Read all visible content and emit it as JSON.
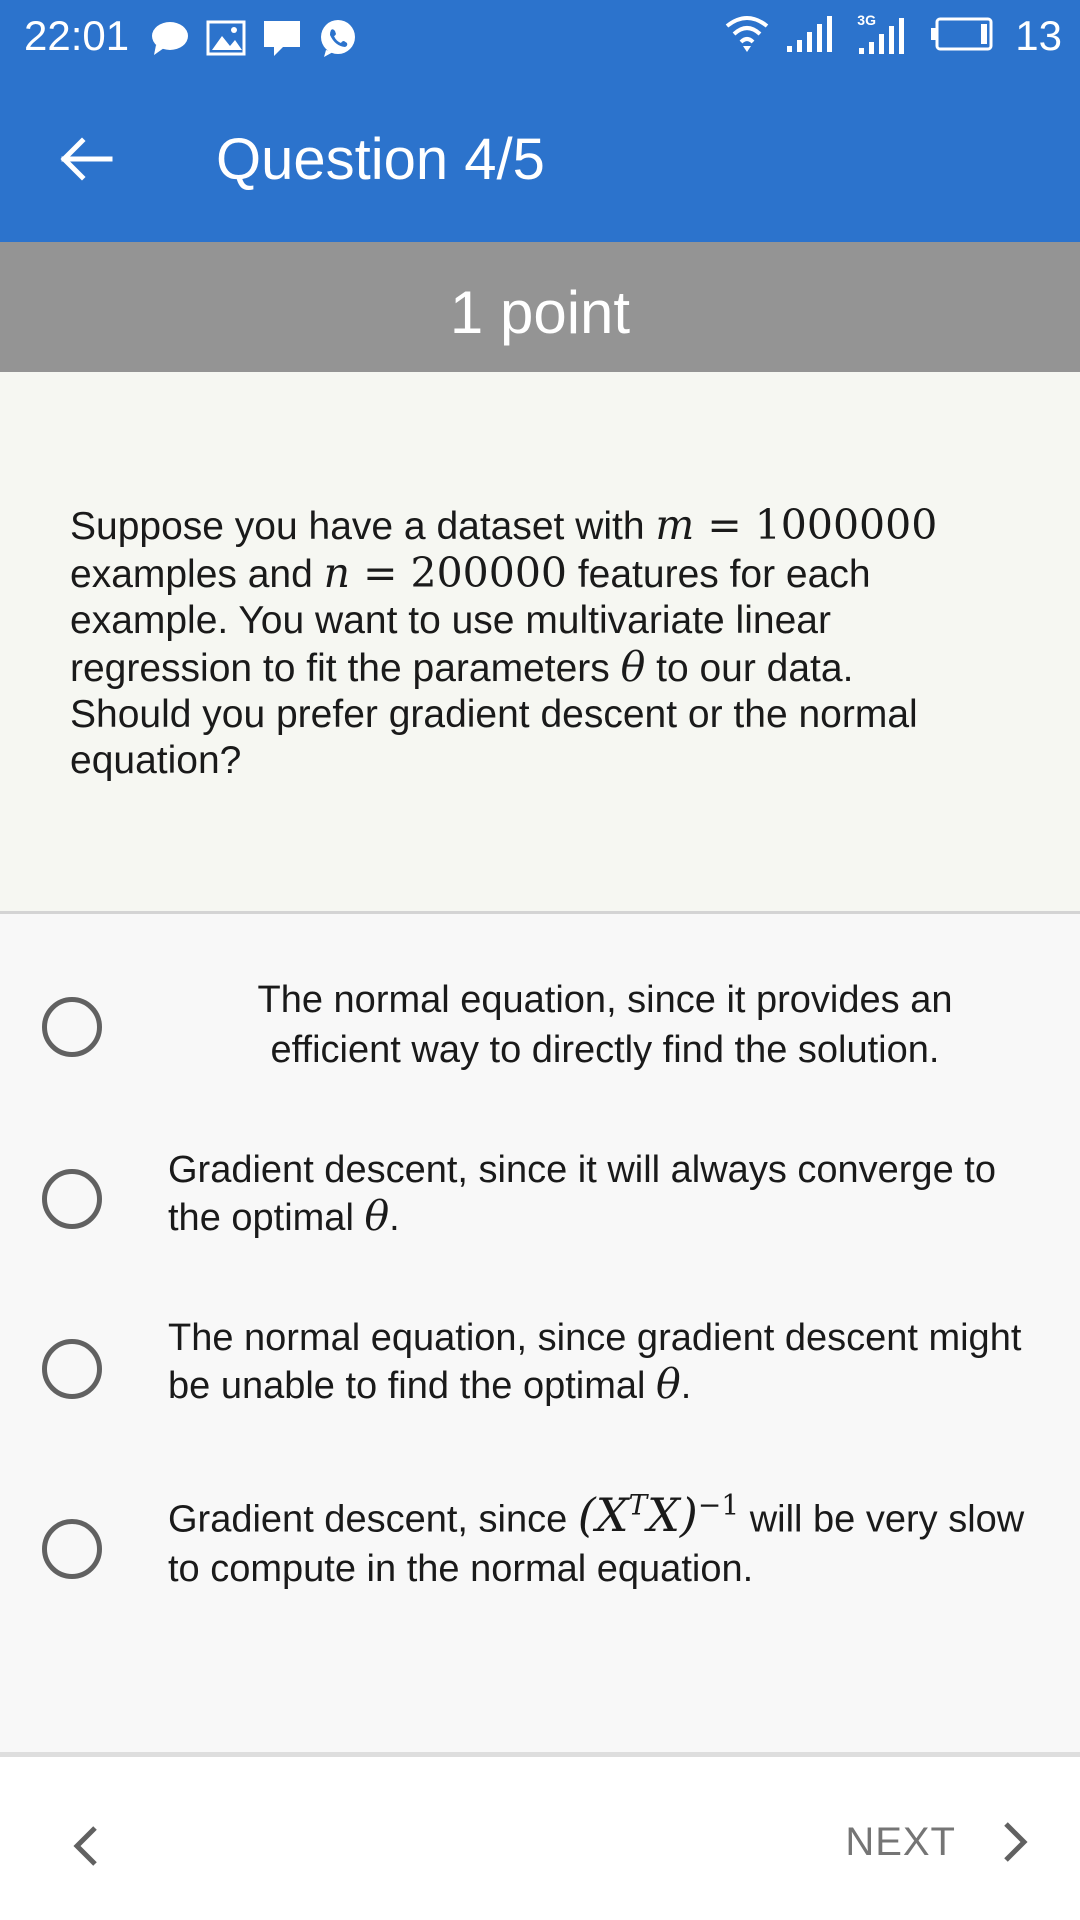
{
  "status_bar": {
    "time": "22:01",
    "battery_level": "13",
    "network_label": "3G",
    "icons_left": [
      "chat-bubble-icon",
      "image-icon",
      "message-icon",
      "viber-icon"
    ],
    "icons_right": [
      "wifi-icon",
      "signal-icon",
      "signal-3g-icon",
      "battery-icon"
    ]
  },
  "app_bar": {
    "title": "Question 4/5",
    "back_icon": "arrow-left-icon",
    "color": "#2c73cc"
  },
  "points": {
    "label": "1 point",
    "color": "#949494"
  },
  "question": {
    "t1": "Suppose you have a dataset with ",
    "m_var": "m",
    "eq1": " = ",
    "m_val": "1000000",
    "t2": " examples and ",
    "n_var": "n",
    "eq2": " = ",
    "n_val": "200000",
    "t3": " features for each example. You want to use multivariate linear regression to fit the parameters ",
    "theta": "θ",
    "t4": " to our data. Should you prefer gradient descent or the normal equation?"
  },
  "options": [
    {
      "text": "The normal equation, since it provides an efficient way to directly find the solution."
    },
    {
      "text": "Gradient descent, since it will always converge to the optimal ",
      "theta": "θ",
      "end": "."
    },
    {
      "text": "The normal equation, since gradient descent might be unable to find the optimal ",
      "theta": "θ",
      "end": "."
    },
    {
      "pre": "Gradient descent, since ",
      "formula_base": "(X",
      "formula_sup_T": "T",
      "formula_mid": "X)",
      "formula_sup": "−1",
      "post": " will be very slow to compute in the normal equation."
    }
  ],
  "navigation": {
    "prev_icon": "chevron-left-icon",
    "next_label": "NEXT",
    "next_icon": "chevron-right-icon"
  }
}
